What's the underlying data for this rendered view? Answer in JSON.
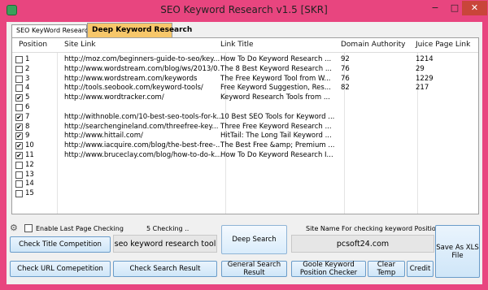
{
  "window": {
    "title": "SEO Keyword Research v1.5 [SKR]",
    "minimize": "−",
    "maximize": "□",
    "close": "✕"
  },
  "tabs": [
    {
      "label": "SEO KeyWord Research"
    },
    {
      "label": "Deep Keyword Research"
    }
  ],
  "grid": {
    "columns": [
      "Position",
      "Site Link",
      "Link Title",
      "Domain Authority",
      "Juice Page Link"
    ],
    "rows": [
      {
        "checked": false,
        "position": "1",
        "link": "http://moz.com/beginners-guide-to-seo/key...",
        "title": "How To Do Keyword Research ...",
        "da": "92",
        "juice": "1214"
      },
      {
        "checked": false,
        "position": "2",
        "link": "http://www.wordstream.com/blog/ws/2013/0...",
        "title": "The 8 Best Keyword Research ...",
        "da": "76",
        "juice": "29"
      },
      {
        "checked": false,
        "position": "3",
        "link": "http://www.wordstream.com/keywords",
        "title": "The Free Keyword Tool from W...",
        "da": "76",
        "juice": "1229"
      },
      {
        "checked": false,
        "position": "4",
        "link": "http://tools.seobook.com/keyword-tools/",
        "title": "Free Keyword Suggestion, Res...",
        "da": "82",
        "juice": "217"
      },
      {
        "checked": true,
        "position": "5",
        "link": "http://www.wordtracker.com/",
        "title": "Keyword Research Tools from ...",
        "da": "",
        "juice": ""
      },
      {
        "checked": false,
        "position": "6",
        "link": "",
        "title": "",
        "da": "",
        "juice": ""
      },
      {
        "checked": true,
        "position": "7",
        "link": "http://withnoble.com/10-best-seo-tools-for-k...",
        "title": "10 Best SEO Tools for Keyword ...",
        "da": "",
        "juice": ""
      },
      {
        "checked": true,
        "position": "8",
        "link": "http://searchengineland.com/threefree-key...",
        "title": "Three Free Keyword Research ...",
        "da": "",
        "juice": ""
      },
      {
        "checked": true,
        "position": "9",
        "link": "http://www.hittail.com/",
        "title": "HitTail: The Long Tail Keyword ...",
        "da": "",
        "juice": ""
      },
      {
        "checked": true,
        "position": "10",
        "link": "http://www.iacquire.com/blog/the-best-free-...",
        "title": "The Best Free &amp; Premium ...",
        "da": "",
        "juice": ""
      },
      {
        "checked": true,
        "position": "11",
        "link": "http://www.bruceclay.com/blog/how-to-do-k...",
        "title": "How To Do Keyword Research I...",
        "da": "",
        "juice": ""
      },
      {
        "checked": false,
        "position": "12",
        "link": "",
        "title": "",
        "da": "",
        "juice": ""
      },
      {
        "checked": false,
        "position": "13",
        "link": "",
        "title": "",
        "da": "",
        "juice": ""
      },
      {
        "checked": false,
        "position": "14",
        "link": "",
        "title": "",
        "da": "",
        "juice": ""
      },
      {
        "checked": false,
        "position": "15",
        "link": "",
        "title": "",
        "da": "",
        "juice": ""
      }
    ]
  },
  "controls": {
    "enable_last_page": "Enable Last Page Checking",
    "checking_status": "5 Checking ..",
    "site_name_label": "Site Name For checking keyword Position",
    "keyword_value": "seo keyword research tool",
    "site_value": "pcsoft24.com",
    "check_title": "Check Title Competition",
    "check_url": "Check URL Comepetition",
    "check_search": "Check Search Result",
    "deep_search": "Deep Search",
    "general_search": "General Search Result",
    "goole_position": "Goole Keyword Position Checker",
    "clear_temp": "Clear Temp",
    "credit": "Credit",
    "save_xls": "Save As XLS File"
  },
  "icons": {
    "app": "app-icon",
    "gear": "gear-icon"
  }
}
